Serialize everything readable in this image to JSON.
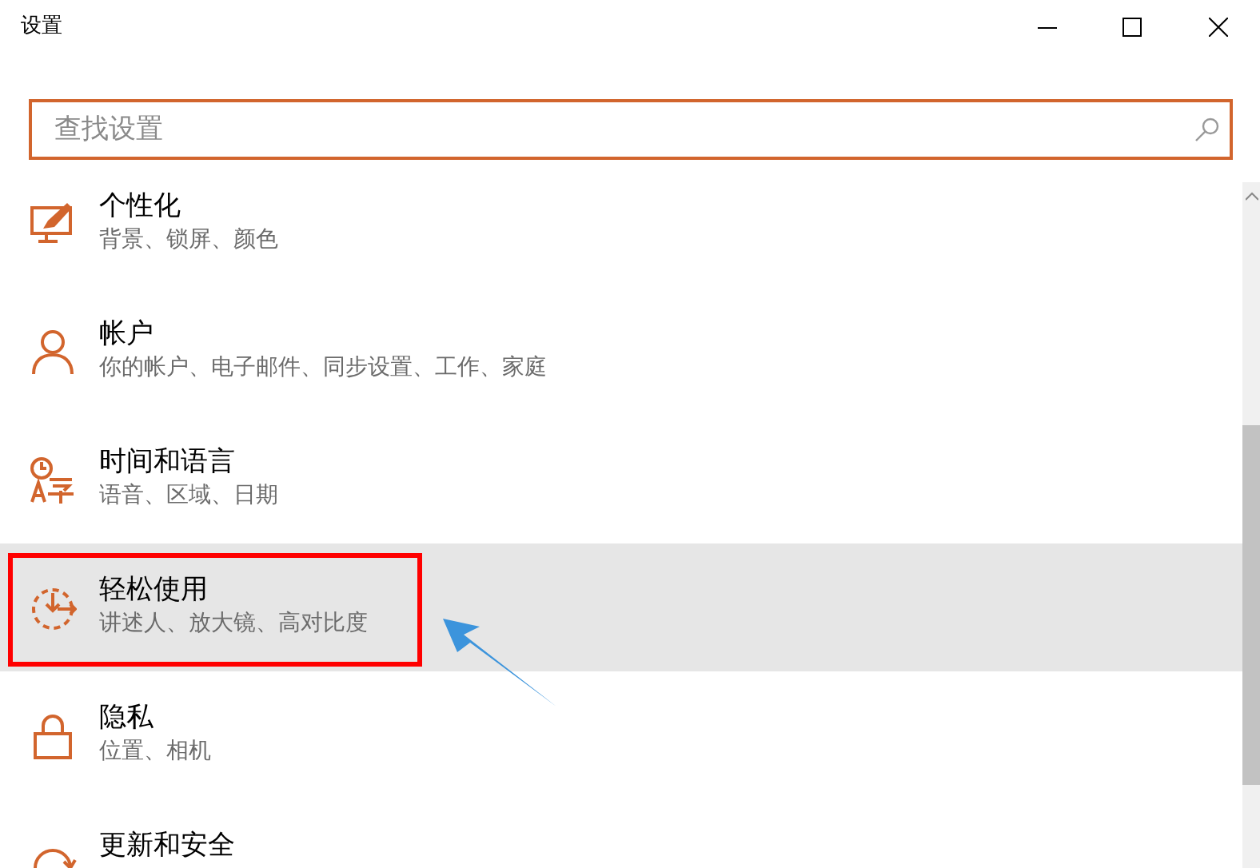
{
  "window": {
    "title": "设置"
  },
  "search": {
    "placeholder": "查找设置"
  },
  "items": [
    {
      "title": "个性化",
      "subtitle": "背景、锁屏、颜色",
      "selected": false
    },
    {
      "title": "帐户",
      "subtitle": "你的帐户、电子邮件、同步设置、工作、家庭",
      "selected": false
    },
    {
      "title": "时间和语言",
      "subtitle": "语音、区域、日期",
      "selected": false
    },
    {
      "title": "轻松使用",
      "subtitle": "讲述人、放大镜、高对比度",
      "selected": true
    },
    {
      "title": "隐私",
      "subtitle": "位置、相机",
      "selected": false
    },
    {
      "title": "更新和安全",
      "selected": false
    }
  ]
}
